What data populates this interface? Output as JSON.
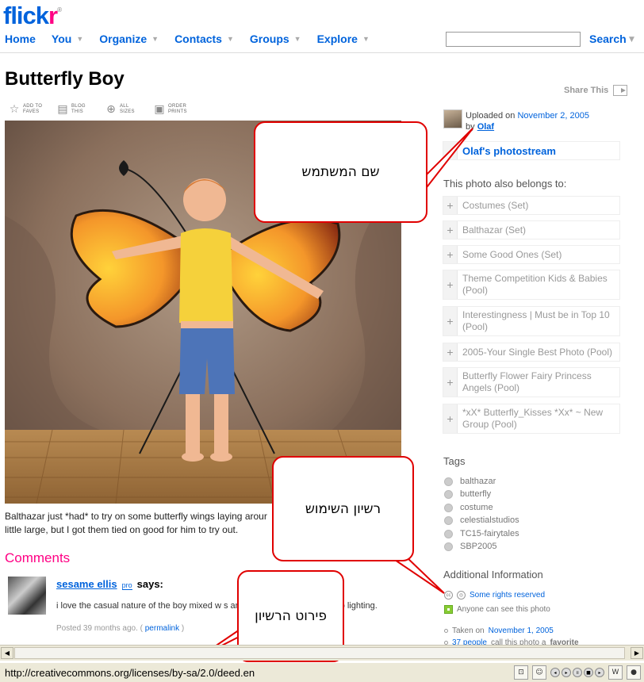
{
  "header": {
    "logo_main": "flick",
    "logo_accent": "r",
    "logo_tm": "®",
    "nav": [
      "Home",
      "You",
      "Organize",
      "Contacts",
      "Groups",
      "Explore"
    ],
    "search_button": "Search"
  },
  "photo": {
    "title": "Butterfly Boy",
    "share_label": "Share This",
    "toolbar": [
      {
        "label": "ADD TO FAVES",
        "icon": "star-icon"
      },
      {
        "label": "BLOG THIS",
        "icon": "blog-icon"
      },
      {
        "label": "ALL SIZES",
        "icon": "magnifier-icon"
      },
      {
        "label": "ORDER PRINTS",
        "icon": "printer-icon"
      }
    ],
    "caption": "Balthazar just *had* to try on some butterfly wings laying arour little large, but I got them tied on good for him to try out."
  },
  "comments": {
    "heading": "Comments",
    "items": [
      {
        "user": "sesame ellis",
        "badge": "pro",
        "says": "says:",
        "text": "i love the casual nature of the boy mixed w s and the formality of the studio lighting.",
        "posted": "Posted 39 months ago. (",
        "permalink": "permalink",
        "close": ")"
      }
    ]
  },
  "sidebar": {
    "uploaded_prefix": "Uploaded on",
    "uploaded_date": "November 2, 2005",
    "by_prefix": "by",
    "owner": "Olaf",
    "photostream": "Olaf's photostream",
    "belongs_heading": "This photo also belongs to:",
    "sets": [
      "Costumes (Set)",
      "Balthazar (Set)",
      "Some Good Ones (Set)",
      "Theme Competition Kids & Babies (Pool)",
      "Interestingness | Must be in Top 10 (Pool)",
      "2005-Your Single Best Photo (Pool)",
      "Butterfly Flower Fairy Princess Angels (Pool)",
      "*xX* Butterfly_Kisses *Xx* ~ New Group (Pool)"
    ],
    "tags_heading": "Tags",
    "tags": [
      "balthazar",
      "butterfly",
      "costume",
      "celestialstudios",
      "TC15-fairytales",
      "SBP2005"
    ],
    "addinfo_heading": "Additional Information",
    "license": "Some rights reserved",
    "visibility": "Anyone can see this photo",
    "taken_prefix": "Taken on",
    "taken_date": "November 1, 2005",
    "fav_count": "37 people",
    "fav_text": "call this photo a",
    "fav_word": "favorite"
  },
  "annotations": {
    "username": "שם המשתמש",
    "license": "רשיון השימוש",
    "license_details": "פירוט הרשיון"
  },
  "browser": {
    "status_url": "http://creativecommons.org/licenses/by-sa/2.0/deed.en"
  },
  "colors": {
    "flickr_blue": "#0063dc",
    "flickr_pink": "#ff0084",
    "annotation_red": "#e00000"
  }
}
